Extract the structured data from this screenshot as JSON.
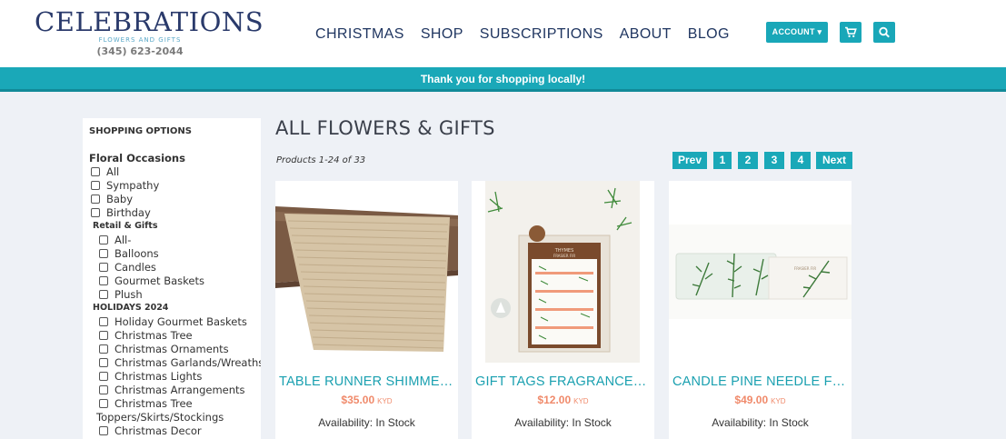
{
  "brand": {
    "name": "CELEBRATIONS",
    "tagline": "FLOWERS AND GIFTS",
    "phone": "(345) 623-2044",
    "accent_color": "#19a7b8",
    "navy_color": "#2a3a6b"
  },
  "nav": {
    "items": [
      "CHRISTMAS",
      "SHOP",
      "SUBSCRIPTIONS",
      "ABOUT",
      "BLOG"
    ],
    "account_label": "ACCOUNT ▾",
    "cart_icon": "cart-icon",
    "search_icon": "search-icon"
  },
  "banner": {
    "text": "Thank you for shopping locally!"
  },
  "sidebar": {
    "title": "SHOPPING OPTIONS",
    "floral_heading": "Floral Occasions",
    "floral_options": [
      "All",
      "Sympathy",
      "Baby",
      "Birthday"
    ],
    "retail_heading": "Retail & Gifts",
    "retail_options": [
      "All-",
      "Balloons",
      "Candles",
      "Gourmet Baskets",
      "Plush"
    ],
    "holidays_heading": "HOLIDAYS 2024",
    "holiday_options": [
      "Holiday Gourmet Baskets",
      "Christmas Tree",
      "Christmas Ornaments",
      "Christmas Garlands/Wreaths",
      "Christmas Lights",
      "Christmas Arrangements",
      "Christmas Tree"
    ],
    "holiday_wrap_text": "Toppers/Skirts/Stockings",
    "holiday_last": "Christmas Decor"
  },
  "main": {
    "title": "ALL FLOWERS & GIFTS",
    "count_text": "Products 1-24 of 33",
    "pager": [
      "Prev",
      "1",
      "2",
      "3",
      "4",
      "Next"
    ]
  },
  "products": [
    {
      "name": "TABLE RUNNER SHIMMER...",
      "price": "$35.00",
      "currency": "KYD",
      "availability": "Availability: In Stock"
    },
    {
      "name": "GIFT TAGS FRAGRANCED ...",
      "price": "$12.00",
      "currency": "KYD",
      "availability": "Availability: In Stock"
    },
    {
      "name": "CANDLE PINE NEEDLE FR...",
      "price": "$49.00",
      "currency": "KYD",
      "availability": "Availability: In Stock"
    }
  ],
  "product_art": {
    "tag_brand": "THYMES",
    "tag_title": "FRASIER FIR",
    "candle_label": "FRASIER FIR"
  }
}
